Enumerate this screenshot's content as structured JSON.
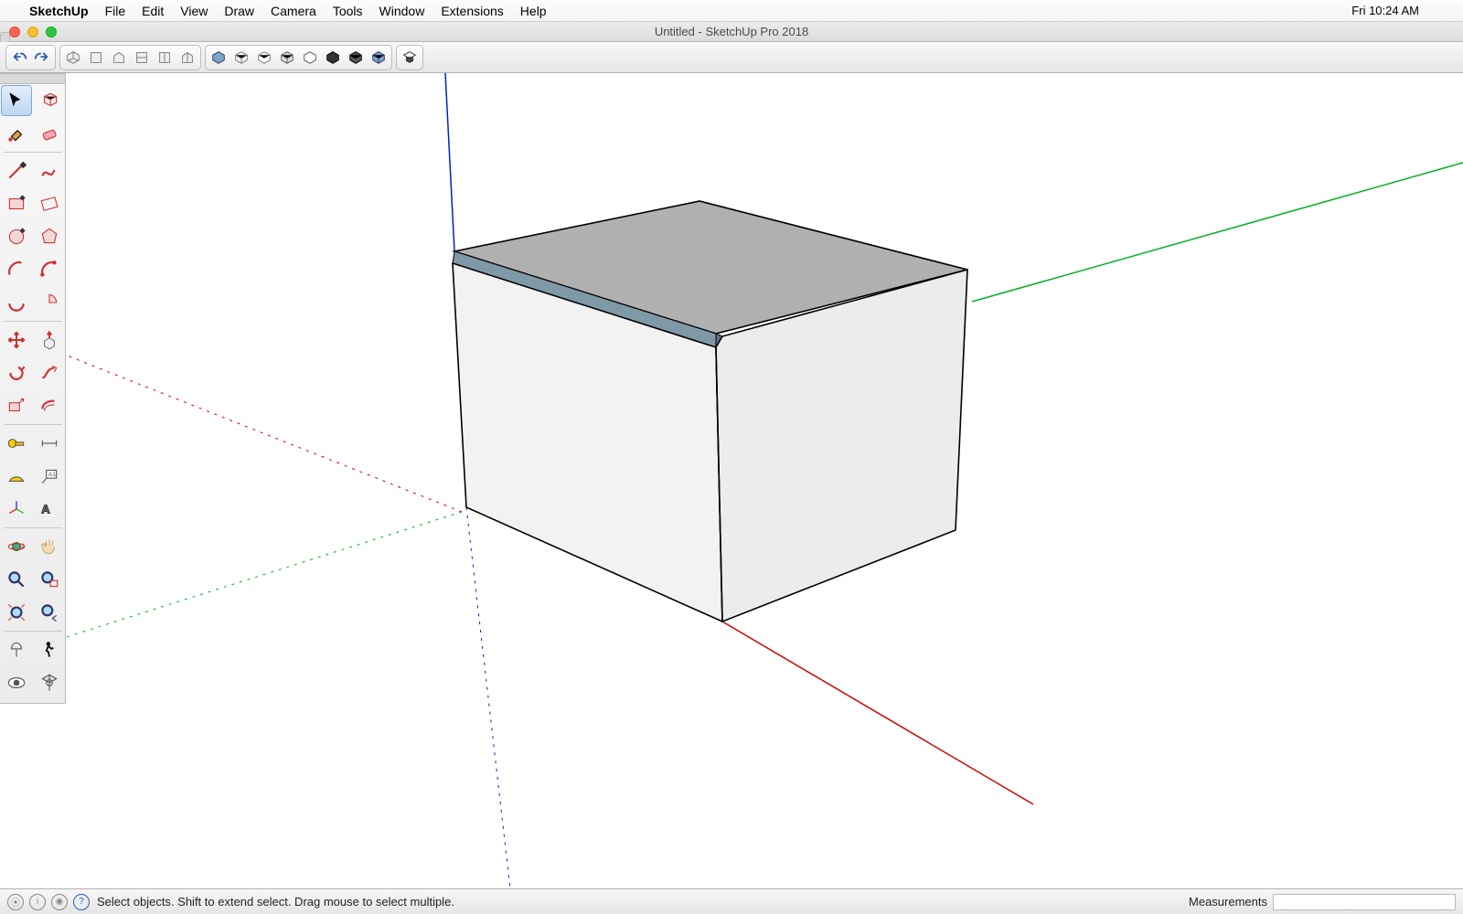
{
  "menubar": {
    "app_name": "SketchUp",
    "items": [
      "File",
      "Edit",
      "View",
      "Draw",
      "Camera",
      "Tools",
      "Window",
      "Extensions",
      "Help"
    ],
    "clock": "Fri 10:24 AM"
  },
  "window": {
    "title": "Untitled - SketchUp Pro 2018"
  },
  "toolbar": {
    "nav": {
      "undo": "undo-icon",
      "redo": "redo-icon"
    },
    "scene": [
      "component-icon",
      "group-icon",
      "home-icon",
      "prev-scene-icon",
      "next-scene-icon",
      "scene-home-icon"
    ],
    "style": [
      "shaded-icon",
      "wire-icon",
      "hidden-icon",
      "mono-icon",
      "shaded-tex-icon",
      "xray-icon",
      "back-edges-icon",
      "texture-icon"
    ],
    "warehouse": "warehouse-icon"
  },
  "palette": {
    "rows": [
      [
        "select",
        "component-make"
      ],
      [
        "paint",
        "eraser"
      ],
      "sep",
      [
        "line",
        "freehand"
      ],
      [
        "rectangle",
        "rectangle-rot"
      ],
      [
        "circle",
        "polygon"
      ],
      [
        "arc",
        "arc-2pt"
      ],
      [
        "arc-3pt",
        "pie"
      ],
      "sep",
      [
        "move",
        "pushpull"
      ],
      [
        "rotate",
        "followme"
      ],
      [
        "scale",
        "offset"
      ],
      "sep",
      [
        "tape",
        "dimension"
      ],
      [
        "protractor",
        "text"
      ],
      [
        "axes",
        "3dtext"
      ],
      "sep",
      [
        "orbit",
        "pan"
      ],
      [
        "zoom",
        "zoom-window"
      ],
      [
        "zoom-extents",
        "previous-view"
      ],
      "sep",
      [
        "position-camera",
        "walk"
      ],
      [
        "look-around",
        "section"
      ]
    ],
    "selected": "select"
  },
  "statusbar": {
    "hint": "Select objects. Shift to extend select. Drag mouse to select multiple.",
    "meas_label": "Measurements",
    "meas_value": ""
  }
}
